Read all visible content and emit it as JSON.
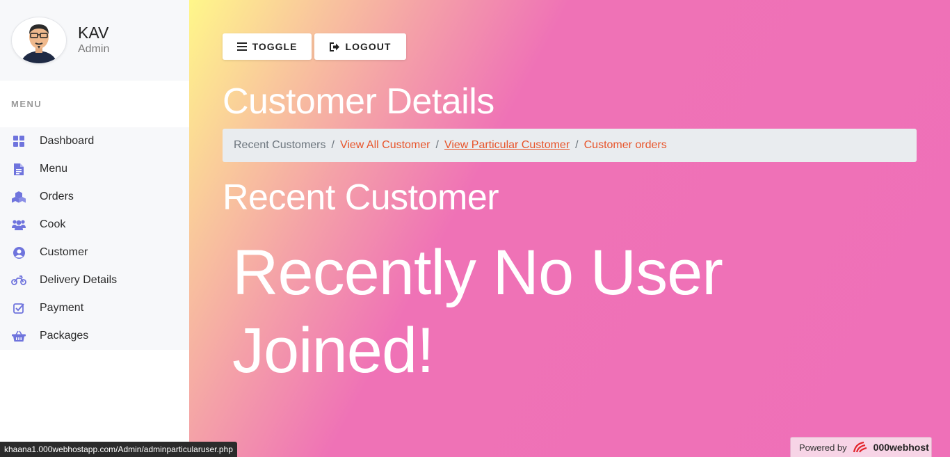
{
  "profile": {
    "name": "KAV",
    "role": "Admin",
    "avatar_icon": "user-avatar-icon"
  },
  "sidebar": {
    "menu_label": "MENU",
    "items": [
      {
        "label": "Dashboard",
        "icon": "dashboard-icon"
      },
      {
        "label": "Menu",
        "icon": "document-icon"
      },
      {
        "label": "Orders",
        "icon": "cubes-icon"
      },
      {
        "label": "Cook",
        "icon": "users-icon"
      },
      {
        "label": "Customer",
        "icon": "user-circle-icon"
      },
      {
        "label": "Delivery Details",
        "icon": "motorcycle-icon"
      },
      {
        "label": "Payment",
        "icon": "check-square-icon"
      },
      {
        "label": "Packages",
        "icon": "basket-icon"
      }
    ],
    "icon_color": "#6f74dd"
  },
  "toolbar": {
    "toggle_label": "TOGGLE",
    "logout_label": "LOGOUT"
  },
  "main": {
    "page_title": "Customer Details",
    "breadcrumb": [
      "Recent Customers",
      "View All Customer",
      "View Particular Customer",
      "Customer orders"
    ],
    "section_title": "Recent Customer",
    "empty_message": "Recently No User Joined!"
  },
  "colors": {
    "link": "#e8542a",
    "gradient_start": "#fff78a",
    "gradient_end": "#ef70b8"
  },
  "statusbar": {
    "url": "khaana1.000webhostapp.com/Admin/adminparticularuser.php"
  },
  "badge": {
    "prefix": "Powered by",
    "brand": "000webhost"
  }
}
